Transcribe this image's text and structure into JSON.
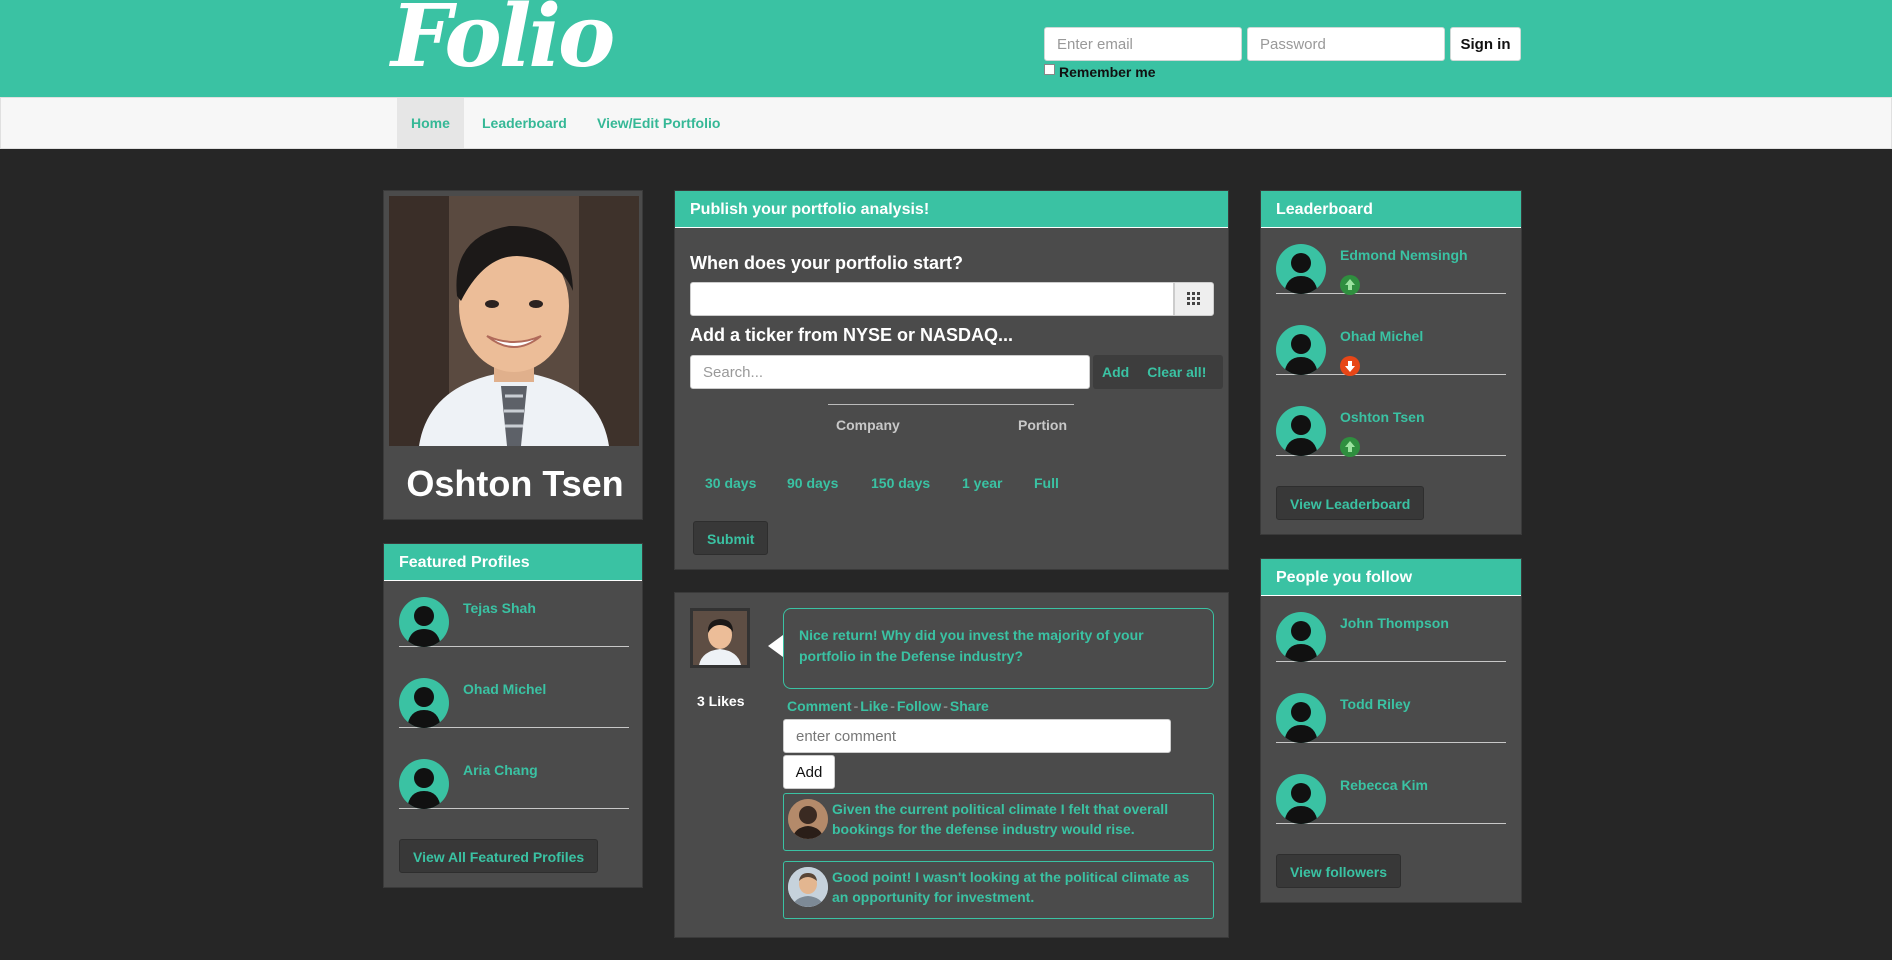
{
  "header": {
    "logo": "Folio",
    "email_placeholder": "Enter email",
    "password_placeholder": "Password",
    "signin_label": "Sign in",
    "remember_label": "Remember me"
  },
  "nav": {
    "items": [
      {
        "label": "Home",
        "active": true
      },
      {
        "label": "Leaderboard"
      },
      {
        "label": "View/Edit Portfolio"
      }
    ]
  },
  "profile": {
    "name": "Oshton Tsen"
  },
  "featured": {
    "title": "Featured Profiles",
    "people": [
      "Tejas Shah",
      "Ohad Michel",
      "Aria Chang"
    ],
    "button": "View All Featured Profiles"
  },
  "publish": {
    "title": "Publish your portfolio analysis!",
    "start_question": "When does your portfolio start?",
    "ticker_label": "Add a ticker from NYSE or NASDAQ...",
    "search_placeholder": "Search...",
    "add_label": "Add",
    "clear_label": "Clear all!",
    "col_company": "Company",
    "col_portion": "Portion",
    "ranges": [
      "30 days",
      "90 days",
      "150 days",
      "1 year",
      "Full"
    ],
    "submit_label": "Submit"
  },
  "post": {
    "likes": "3 Likes",
    "text": "Nice return! Why did you invest the majority of your portfolio in the Defense industry?",
    "actions": [
      "Comment",
      "Like",
      "Follow",
      "Share"
    ],
    "comment_placeholder": "enter comment",
    "add_label": "Add",
    "comments": [
      "Given the current political climate I felt that overall bookings for the defense industry would rise.",
      "Good point! I wasn't looking at the political climate as an opportunity for investment."
    ]
  },
  "leaderboard": {
    "title": "Leaderboard",
    "people": [
      {
        "name": "Edmond Nemsingh",
        "trend": "up"
      },
      {
        "name": "Ohad Michel",
        "trend": "down"
      },
      {
        "name": "Oshton Tsen",
        "trend": "up"
      }
    ],
    "button": "View Leaderboard"
  },
  "following": {
    "title": "People you follow",
    "people": [
      "John Thompson",
      "Todd Riley",
      "Rebecca Kim"
    ],
    "button": "View followers"
  },
  "colors": {
    "accent": "#3ac2a3",
    "background": "#262626",
    "panel": "#4b4b4b",
    "trend_up": "#2f8f3f",
    "trend_down": "#e74617"
  }
}
